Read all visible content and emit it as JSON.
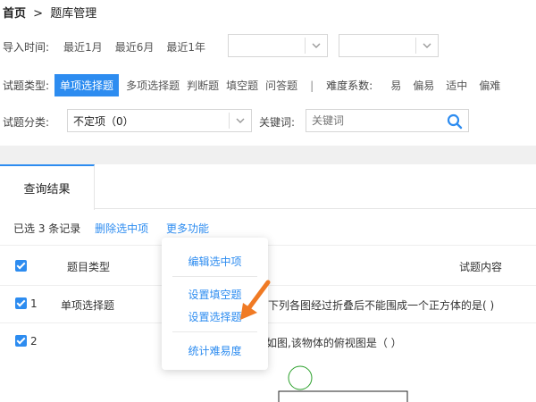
{
  "breadcrumb": {
    "home": "首页",
    "separator": ">",
    "current": "题库管理"
  },
  "import_time": {
    "label": "导入时间:",
    "options": [
      "最近1月",
      "最近6月",
      "最近1年"
    ],
    "start_date": "",
    "end_date": ""
  },
  "question_type": {
    "label": "试题类型:",
    "options": [
      "单项选择题",
      "多项选择题",
      "判断题",
      "填空题",
      "问答题"
    ],
    "active": "单项选择题",
    "separator": "|",
    "difficulty_label": "难度系数:",
    "difficulty_options": [
      "易",
      "偏易",
      "适中",
      "偏难"
    ]
  },
  "category": {
    "label": "试题分类:",
    "value": "不定项（0）"
  },
  "keyword": {
    "label": "关键词:",
    "placeholder": "关键词"
  },
  "results": {
    "tab_label": "查询结果",
    "selected_count_text": "已选 3 条记录",
    "delete_link": "删除选中项",
    "more_link": "更多功能",
    "columns": {
      "type": "题目类型",
      "content": "试题内容"
    },
    "rows": [
      {
        "index": "1",
        "type": "单项选择题",
        "content": "下列各图经过折叠后不能围成一个正方体的是(     )"
      },
      {
        "index": "2",
        "type": "",
        "content": "如图,该物体的俯视图是（    ）"
      }
    ]
  },
  "more_menu": {
    "edit": "编辑选中项",
    "set_fill": "设置填空题",
    "set_choice": "设置选择题",
    "stats": "统计难易度"
  },
  "colors": {
    "accent": "#2d8cf0",
    "arrow": "#f07a24"
  }
}
